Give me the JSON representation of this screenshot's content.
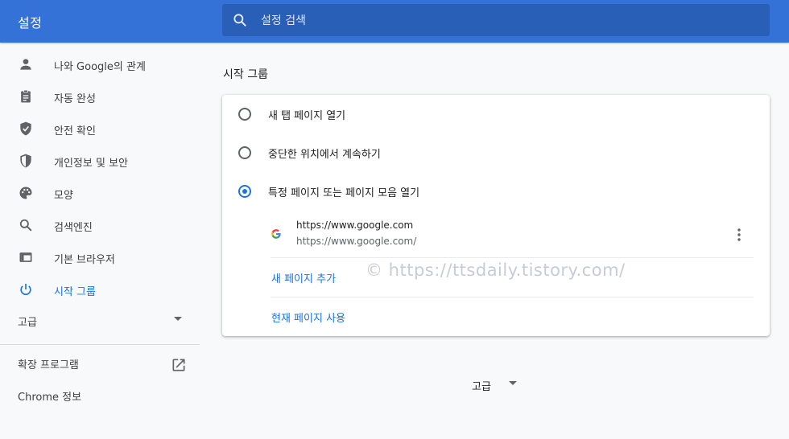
{
  "header": {
    "title": "설정",
    "search_placeholder": "설정 검색"
  },
  "sidebar": {
    "items": [
      {
        "label": "나와 Google의 관계",
        "icon": "person-icon"
      },
      {
        "label": "자동 완성",
        "icon": "clipboard-icon"
      },
      {
        "label": "안전 확인",
        "icon": "shield-check-icon"
      },
      {
        "label": "개인정보 및 보안",
        "icon": "shield-half-icon"
      },
      {
        "label": "모양",
        "icon": "palette-icon"
      },
      {
        "label": "검색엔진",
        "icon": "search-icon"
      },
      {
        "label": "기본 브라우저",
        "icon": "browser-icon"
      },
      {
        "label": "시작 그룹",
        "icon": "power-icon",
        "active": true
      }
    ],
    "advanced_label": "고급",
    "extensions_label": "확장 프로그램",
    "about_label": "Chrome 정보"
  },
  "main": {
    "section_title": "시작 그룹",
    "options": [
      {
        "label": "새 탭 페이지 열기",
        "checked": false
      },
      {
        "label": "중단한 위치에서 계속하기",
        "checked": false
      },
      {
        "label": "특정 페이지 또는 페이지 모음 열기",
        "checked": true
      }
    ],
    "pages": [
      {
        "title": "https://www.google.com",
        "url": "https://www.google.com/"
      }
    ],
    "add_page_label": "새 페이지 추가",
    "use_current_label": "현재 페이지 사용",
    "advanced_label": "고급"
  },
  "watermark": "© https://ttsdaily.tistory.com/",
  "colors": {
    "header_bg": "#3572d8",
    "search_bg": "#2a5fb7",
    "accent": "#1a73e8",
    "background": "#f8f9fa"
  }
}
